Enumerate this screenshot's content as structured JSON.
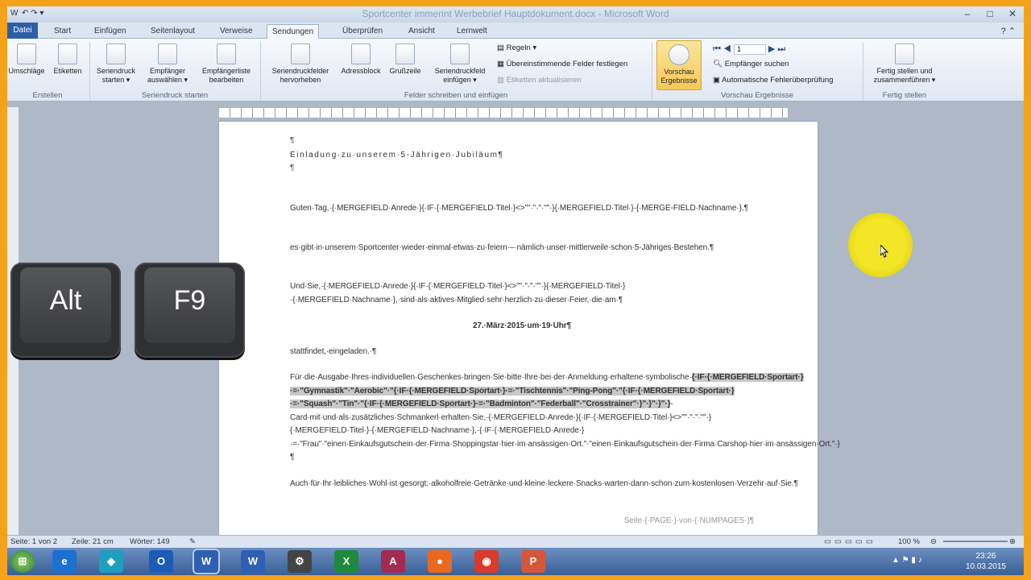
{
  "window": {
    "title": "Sportcenter immerint Werbebrief Hauptdokument.docx - Microsoft Word",
    "qat": "↶ ↷ ▾"
  },
  "tabs": [
    "Datei",
    "Start",
    "Einfügen",
    "Seitenlayout",
    "Verweise",
    "Sendungen",
    "Überprüfen",
    "Ansicht",
    "Lernwelt"
  ],
  "ribbon": {
    "umschlaege": "Umschläge",
    "etiketten": "Etiketten",
    "seriendruck_starten": "Seriendruck starten ▾",
    "empfaenger_auswaehlen": "Empfänger auswählen ▾",
    "empfaengerliste_bearbeiten": "Empfängerliste bearbeiten",
    "seriendruckfelder_hervorheben": "Seriendruckfelder hervorheben",
    "adressblock": "Adressblock",
    "grusszeile": "Grußzeile",
    "seriendruckfeld_einfuegen": "Seriendruckfeld einfügen ▾",
    "regeln": "Regeln ▾",
    "uebereinstimmende_felder": "Übereinstimmende Felder festlegen",
    "etiketten_aktualisieren": "Etiketten aktualisieren",
    "vorschau_ergebnisse": "Vorschau Ergebnisse",
    "record_number": "1",
    "empfaenger_suchen": "Empfänger suchen",
    "fehlerueberpruefung": "Automatische Fehlerüberprüfung",
    "fertig_stellen": "Fertig stellen und zusammenführen ▾",
    "group_erstellen": "Erstellen",
    "group_seriendruck_starten": "Seriendruck starten",
    "group_felder": "Felder schreiben und einfügen",
    "group_vorschau": "Vorschau Ergebnisse",
    "group_fertig": "Fertig stellen"
  },
  "document": {
    "p0": "¶",
    "p1": "Einladung·zu·unserem·5-Jährigen·Jubiläum¶",
    "p2": "¶",
    "p3": "Guten·Tag,·{·MERGEFIELD·Anrede·}{·IF·{·MERGEFIELD·Titel·}<>\"\"·\"·\"·\"\"·}{·MERGEFIELD·Titel·}·{·MERGE-FIELD·Nachname·},¶",
    "p4": "es·gibt·in·unserem·Sportcenter·wieder·einmal·etwas·zu·feiern·–·nämlich·unser·mittlerweile·schon·5-Jähriges·Bestehen.¶",
    "p5": "Und·Sie,·{·MERGEFIELD·Anrede·}{·IF·{·MERGEFIELD·Titel·}<>\"\"·\"·\"·\"\"·}{·MERGEFIELD·Titel·}·{·MERGEFIELD·Nachname·},·sind·als·aktives·Mitglied·sehr·herzlich·zu·dieser·Feier,·die·am·¶",
    "p6": "27.·März·2015·um·19·Uhr¶",
    "p7": "stattfindet,·eingeladen.·¶",
    "p8a": "Für·die·Ausgabe·Ihres·individuellen·Geschenkes·bringen·Sie·bitte·Ihre·bei·der·Anmeldung·erhaltene·symbolische·",
    "p8b": "{·IF·{·MERGEFIELD·Sportart·}·=·\"Gymnastik\"·\"Aerobic\"·\"{·IF·{·MERGEFIELD·Sportart·}·=·\"Tischtennis\"·\"Ping-Pong\"·\"{·IF·{·MERGEFIELD·Sportart·}·=·\"Squash\"·\"Tin\"·\"{·IF·{·MERGEFIELD·Sportart·}·=·\"Badminton\"·\"Federball\"·\"Crosstrainer\"·}\"·}\"·}\"·}",
    "p8c": "-Card·mit·und·als·zusätzliches·Schmankerl·erhalten·Sie,·{·MERGEFIELD·Anrede·}{·IF·{·MERGEFIELD·Titel·}<>\"\"·\"·\"·\"\"·}{·MERGEFIELD·Titel·}·{·MERGEFIELD·Nachname·},·{·IF·{·MERGEFIELD·Anrede·}·=·\"Frau\"·\"einen·Einkaufsgutschein·der·Firma·Shoppingstar·hier·im·ansässigen·Ort.\"·\"einen·Einkaufsgutschein·der·Firma·Carshop·hier·im·ansässigen·Ort.\"·}¶",
    "p9": "Auch·für·Ihr·leibliches·Wohl·ist·gesorgt:·alkoholfreie·Getränke·und·kleine·leckere·Snacks·warten·dann·schon·zum·kostenlosen·Verzehr·auf·Sie.¶",
    "footer": "Seite·{·PAGE·}·von·{·NUMPAGES·}¶"
  },
  "status": {
    "page": "Seite: 1 von 2",
    "zeile": "Zeile: 21 cm",
    "words": "Wörter: 149",
    "zoom": "100 %"
  },
  "taskbar": {
    "time": "23:26",
    "date": "10.03.2015"
  },
  "overlay": {
    "key1": "Alt",
    "key2": "F9"
  },
  "colors": {
    "frame": "#f5a21b",
    "file_tab": "#2c5fa8",
    "highlight_button": "#f7c65a",
    "cursor_highlight": "#f2e626"
  }
}
